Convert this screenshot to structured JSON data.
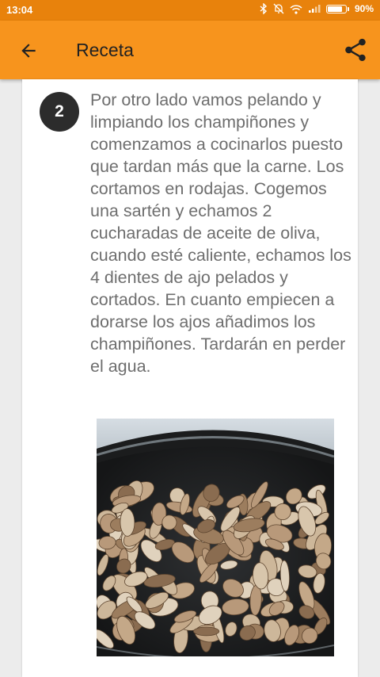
{
  "status_bar": {
    "time": "13:04",
    "battery": "90%",
    "battery_level": 0.9,
    "icons": [
      "bluetooth-icon",
      "silent-bell-icon",
      "wifi-icon",
      "signal-icon",
      "battery-icon"
    ]
  },
  "app_bar": {
    "title": "Receta",
    "back_icon": "arrow-left-icon",
    "share_icon": "share-icon",
    "color": "#f7941d"
  },
  "step": {
    "number": "2",
    "text": "Por otro lado vamos pelando y limpiando los champiñones y comenzamos a cocinarlos puesto que tardan más que la carne. Los cortamos en rodajas. Cogemos una sartén y echamos 2 cucharadas de aceite de oliva, cuando esté caliente, echamos los 4 dientes de ajo pelados y cortados. En cuanto empiecen a dorarse los ajos añadimos los champiñones. Tardarán en perder el agua.",
    "image": "photo of sliced mushrooms frying in a pan"
  }
}
